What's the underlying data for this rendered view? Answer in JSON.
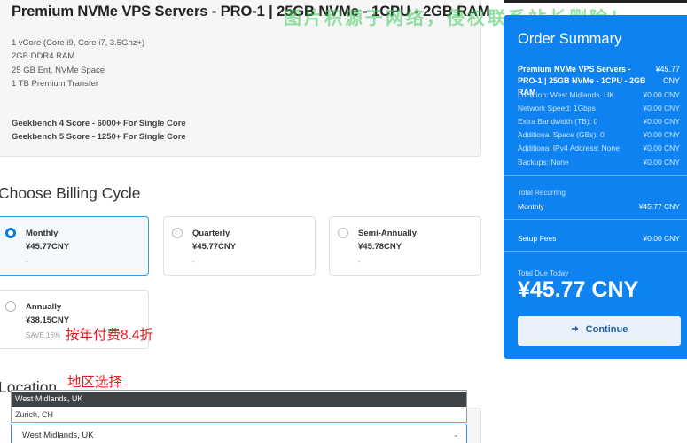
{
  "product": {
    "title": "Premium NVMe VPS Servers - PRO-1 | 25GB NVMe - 1CPU - 2GB RAM",
    "specs": [
      "1 vCore (Core i9, Core i7, 3.5Ghz+)",
      "2GB DDR4 RAM",
      "25 GB Ent. NVMe Space",
      "1 TB Premium Transfer"
    ],
    "benchmarks": [
      "Geekbench 4 Score - 6000+ For Single Core",
      "Geekbench 5 Score - 1250+ For Single Core"
    ]
  },
  "watermark": "图片积源于网络，侵权联系站长删除！",
  "billing": {
    "heading": "Choose Billing Cycle",
    "options": [
      {
        "name": "Monthly",
        "price": "¥45.77CNY",
        "note": "-",
        "selected": true
      },
      {
        "name": "Quarterly",
        "price": "¥45.77CNY",
        "note": "-",
        "selected": false
      },
      {
        "name": "Semi-Annually",
        "price": "¥45.78CNY",
        "note": "-",
        "selected": false
      },
      {
        "name": "Annually",
        "price": "¥38.15CNY",
        "note": "SAVE 16%",
        "selected": false
      }
    ]
  },
  "annotations": {
    "annual_discount": "按年付费8.4折",
    "region_select": "地区选择"
  },
  "location": {
    "heading": "Location",
    "options": [
      "West Midlands, UK",
      "Zurich, CH"
    ],
    "highlighted": "West Midlands, UK",
    "selected_value": "West Midlands, UK"
  },
  "summary": {
    "title": "Order Summary",
    "product_name": "Premium NVMe VPS Servers - PRO-1 | 25GB NVMe - 1CPU - 2GB RAM",
    "product_price": "¥45.77 CNY",
    "rows": [
      {
        "label": "Location: West Midlands, UK",
        "value": "¥0.00 CNY"
      },
      {
        "label": "Network Speed: 1Gbps",
        "value": "¥0.00 CNY"
      },
      {
        "label": "Extra Bandwidth (TB): 0",
        "value": "¥0.00 CNY"
      },
      {
        "label": "Additional Space (GBs): 0",
        "value": "¥0.00 CNY"
      },
      {
        "label": "Additional IPv4 Address: None",
        "value": "¥0.00 CNY"
      },
      {
        "label": "Backups: None",
        "value": "¥0.00 CNY"
      }
    ],
    "total_recurring_label": "Total Recurring",
    "recurring_cycle": "Monthly",
    "recurring_amount": "¥45.77 CNY",
    "setup_fees_label": "Setup Fees",
    "setup_fees_amount": "¥0.00 CNY",
    "total_due_label": "Total Due Today",
    "total_due_amount": "¥45.77 CNY",
    "continue_label": "Continue",
    "continue_icon": "arrow-right-icon"
  },
  "colors": {
    "summary_bg": "#0e82f0",
    "selected_border": "#2d9cdb",
    "annotation_red": "#e02020",
    "watermark_green": "#3cc85a"
  }
}
